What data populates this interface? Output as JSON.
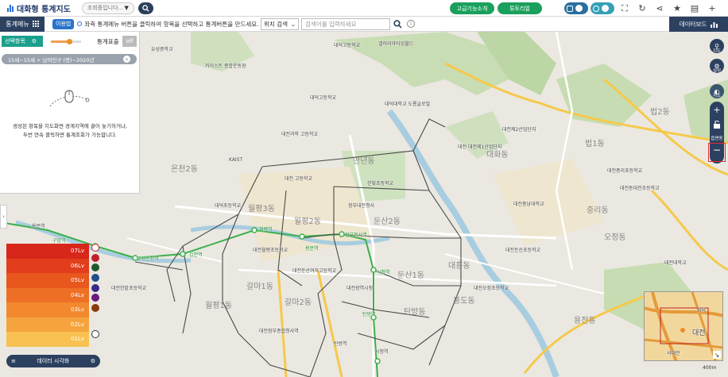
{
  "header": {
    "logo_title": "대화형 통계지도",
    "location_select": "조회중입니다...",
    "btn_advanced": "고급기능소개",
    "btn_tutorial": "튜토리얼"
  },
  "subbar": {
    "stat_menu": "통계메뉴",
    "howto": "이용법",
    "notice": "좌측 통계메뉴 버튼을 클릭하여 항목을 선택하고 통계버튼을 만드세요.",
    "position_search": "위치 검색",
    "address_placeholder": "검색어를 입력하세요",
    "dashboard": "데이터보드"
  },
  "panel": {
    "select_area": "선택항목",
    "stat_display": "통계표출",
    "off": "off",
    "stat_chip": "15세~15세 + 남여인구 (명)~2020년",
    "help_line1": "생성된 항목을 지도화면 경계지역에 끌어 놓기하거나,",
    "help_line2": "두번 연속 클릭하면 통계조회가 가능합니다."
  },
  "legend": {
    "levels": [
      "07Lv",
      "06Lv",
      "05Lv",
      "04Lv",
      "03Lv",
      "02Lv",
      "01Lv"
    ],
    "colors": [
      "#d8261b",
      "#e23d1c",
      "#e8571e",
      "#ee7026",
      "#f2892e",
      "#f5a43d",
      "#f8c152"
    ],
    "swatch_colors": [
      "#c0202a",
      "#1f5a2a",
      "#1f4e8a",
      "#3a2a8a",
      "#6a1a7a",
      "#8a3a0a"
    ],
    "viz_label": "데이터 시각화"
  },
  "right_controls": {
    "map_label": "지도",
    "settings_label": "설정",
    "satellite_label": "지도",
    "zoom_level_label": "읍면동"
  },
  "minimap": {
    "label_daejeon": "대전",
    "label_hwayang": "화덕",
    "label_seodaejeon": "서대전"
  },
  "scale": "400m",
  "map_labels": {
    "dongs": [
      "온천2동",
      "만년동",
      "월평3동",
      "월평2동",
      "둔산2동",
      "둔산1동",
      "갈마2동",
      "갈마1동",
      "월평1동",
      "탄방동",
      "대흥동",
      "중리동",
      "법1동",
      "법2동",
      "오정동",
      "대화동",
      "홍도동",
      "용전동"
    ],
    "places": [
      "유성중학교",
      "대덕고등학교",
      "카이스트 종합운동장",
      "대덕고등학교",
      "대덕대학교 도룡글로벌",
      "대전과학 고등학교",
      "KAIST",
      "대덕초등학교",
      "대전 고등학교",
      "한빛초등학교",
      "정부대전청사",
      "대전월평초등학교",
      "대전광역시청",
      "대전 대전제1산업단지",
      "대전제2산업단지",
      "대전정부종합청사역",
      "대전둔산초등학교",
      "용문역",
      "탄방역",
      "시청역",
      "갤러리아타임월드",
      "대전둔산여자고등학교",
      "대전한밭초등학교",
      "대전중리초등학교",
      "대전동대전초등학교",
      "대전오정초등학교",
      "대전충남대학교",
      "대전대학교"
    ],
    "stations": [
      "유성온천역",
      "갑천역",
      "월평역",
      "정부청사역",
      "시청역",
      "탄방역",
      "용문역",
      "구암역"
    ]
  }
}
